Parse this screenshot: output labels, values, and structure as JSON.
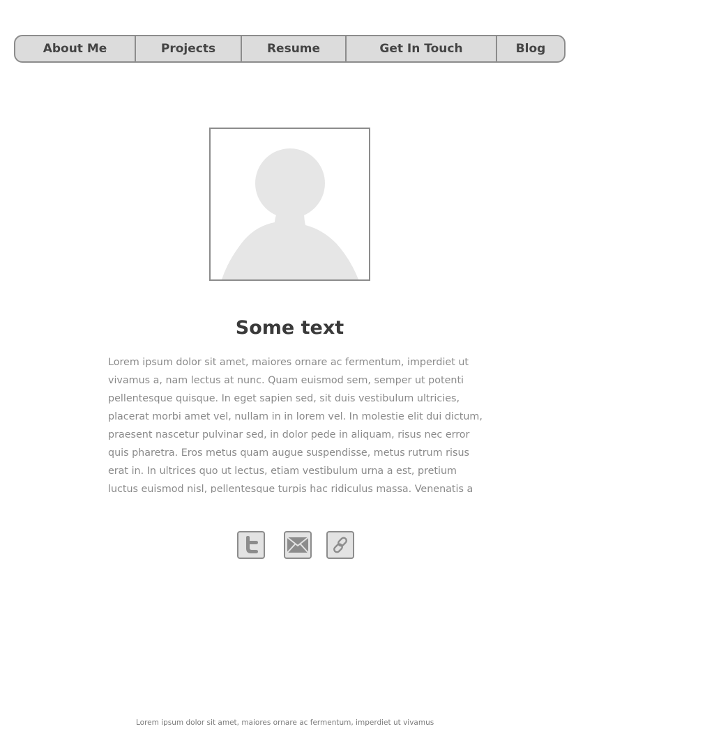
{
  "nav": {
    "items": [
      {
        "label": "About Me"
      },
      {
        "label": "Projects"
      },
      {
        "label": "Resume"
      },
      {
        "label": "Get In Touch"
      },
      {
        "label": "Blog"
      }
    ]
  },
  "profile": {
    "heading": "Some text",
    "body": "Lorem ipsum dolor sit amet, maiores ornare ac fermentum, imperdiet ut vivamus a, nam lectus at nunc. Quam euismod sem, semper ut potenti pellentesque quisque. In eget sapien sed, sit duis vestibulum ultricies, placerat morbi amet vel, nullam in in lorem vel. In molestie elit dui dictum, praesent nascetur pulvinar sed, in dolor pede in aliquam, risus nec error quis pharetra. Eros metus quam augue suspendisse, metus rutrum risus erat in.  In ultrices quo ut lectus, etiam vestibulum urna a est, pretium luctus euismod nisl, pellentesque turpis hac ridiculus massa. Venenatis a"
  },
  "social": {
    "icons": [
      {
        "icon": "twitter-icon"
      },
      {
        "icon": "mail-icon"
      },
      {
        "icon": "link-icon"
      }
    ]
  },
  "footer": {
    "text": "Lorem ipsum dolor sit amet, maiores ornare ac fermentum, imperdiet ut vivamus"
  },
  "colors": {
    "nav_background": "#dcdcdc",
    "border": "#8c8c8c",
    "placeholder_silhouette": "#e6e6e6",
    "heading_text": "#3a3a3a",
    "body_text": "#8a8a8a"
  }
}
